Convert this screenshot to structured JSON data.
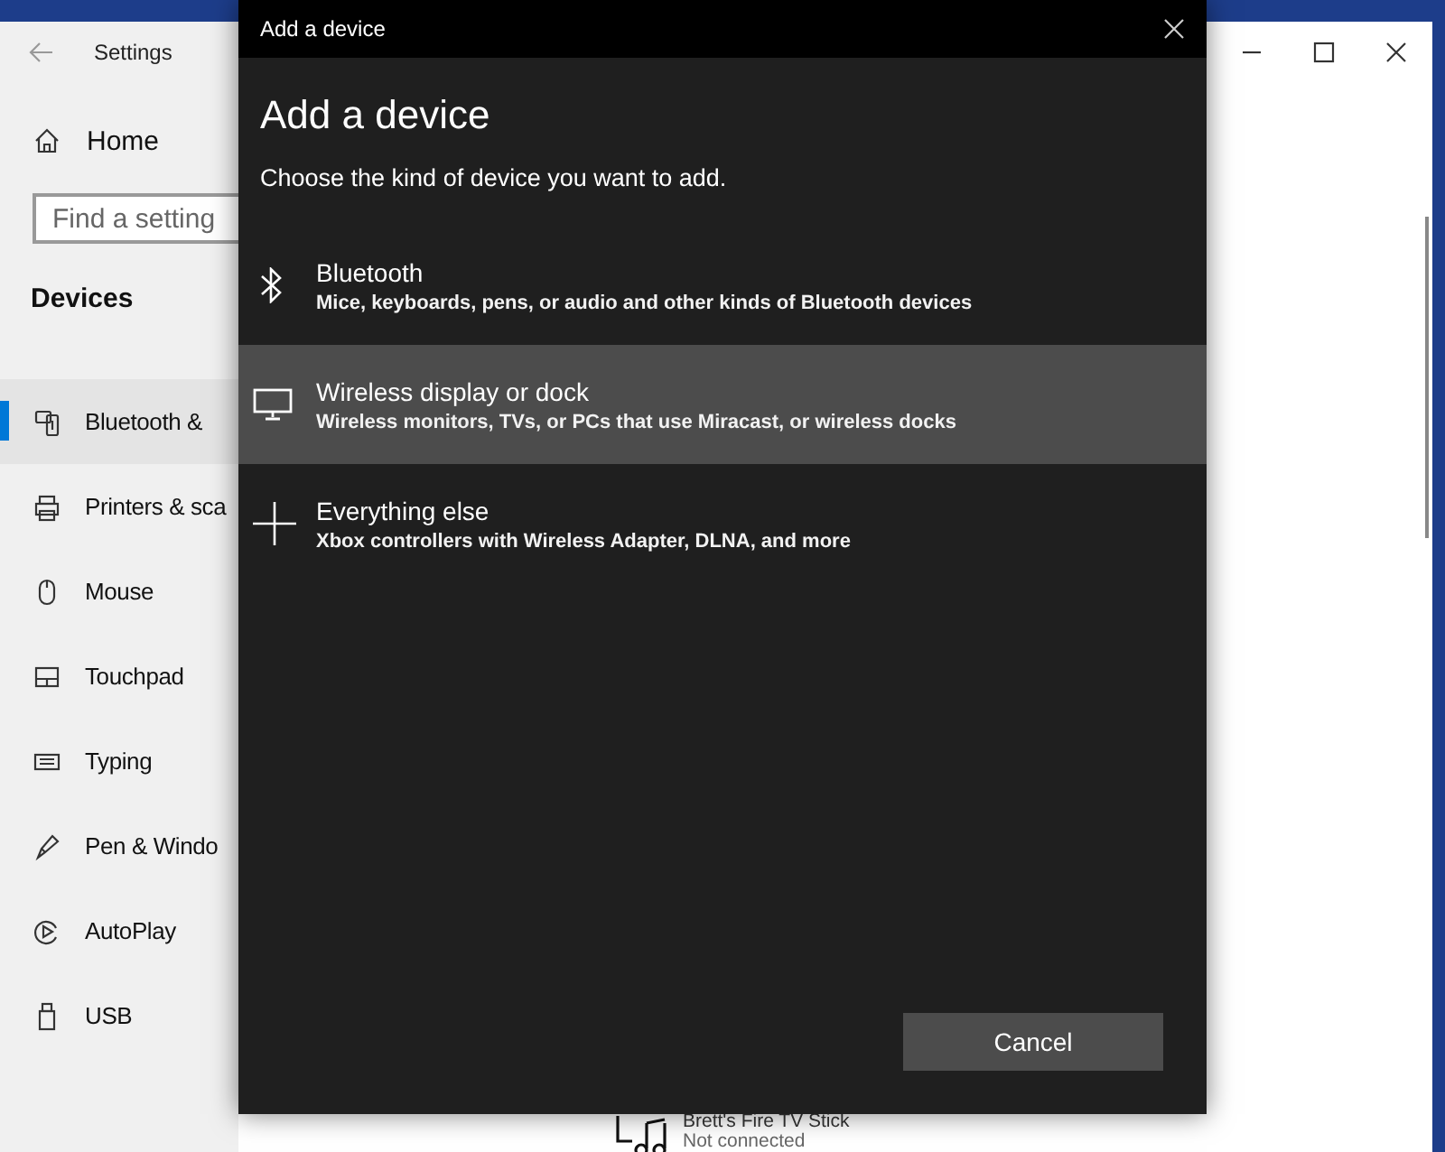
{
  "settings_window": {
    "title": "Settings",
    "home": "Home",
    "search": {
      "placeholder": "Find a setting"
    },
    "section": "Devices",
    "nav_items": [
      {
        "kind": "bluetooth",
        "label": "Bluetooth &",
        "selected": true
      },
      {
        "kind": "printer",
        "label": "Printers & sca",
        "selected": false
      },
      {
        "kind": "mouse",
        "label": "Mouse",
        "selected": false
      },
      {
        "kind": "touchpad",
        "label": "Touchpad",
        "selected": false
      },
      {
        "kind": "typing",
        "label": "Typing",
        "selected": false
      },
      {
        "kind": "pen",
        "label": "Pen & Windo",
        "selected": false
      },
      {
        "kind": "autoplay",
        "label": "AutoPlay",
        "selected": false
      },
      {
        "kind": "usb",
        "label": "USB",
        "selected": false
      }
    ],
    "device": {
      "name": "Brett's Fire TV Stick",
      "status": "Not connected"
    }
  },
  "dialog": {
    "title": "Add a device",
    "heading": "Add a device",
    "prompt": "Choose the kind of device you want to add.",
    "options": [
      {
        "kind": "bluetooth",
        "title": "Bluetooth",
        "description": "Mice, keyboards, pens, or audio and other kinds of Bluetooth devices",
        "selected": false
      },
      {
        "kind": "display",
        "title": "Wireless display or dock",
        "description": "Wireless monitors, TVs, or PCs that use Miracast, or wireless docks",
        "selected": true
      },
      {
        "kind": "other",
        "title": "Everything else",
        "description": "Xbox controllers with Wireless Adapter, DLNA, and more",
        "selected": false
      }
    ],
    "cancel": "Cancel"
  }
}
